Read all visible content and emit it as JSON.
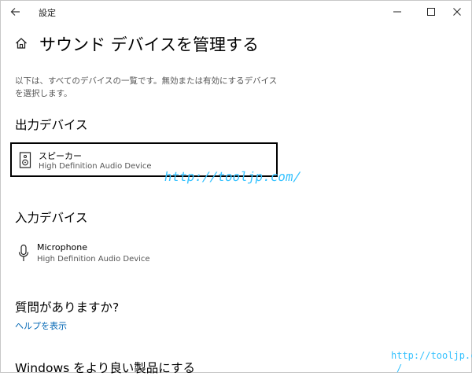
{
  "window": {
    "title": "設定",
    "icons": {
      "back": "back-arrow-icon",
      "minimize": "minimize-icon",
      "maximize": "maximize-icon",
      "close": "close-icon"
    }
  },
  "page": {
    "title": "サウンド デバイスを管理する",
    "description": "以下は、すべてのデバイスの一覧です。無効または有効にするデバイスを選択します。"
  },
  "output_section": {
    "heading": "出力デバイス",
    "devices": [
      {
        "name": "スピーカー",
        "subtitle": "High Definition Audio Device",
        "icon": "speaker-icon"
      }
    ]
  },
  "input_section": {
    "heading": "入力デバイス",
    "devices": [
      {
        "name": "Microphone",
        "subtitle": "High Definition Audio Device",
        "icon": "microphone-icon"
      }
    ]
  },
  "help": {
    "heading": "質問がありますか?",
    "link": "ヘルプを表示"
  },
  "improve": {
    "heading": "Windows をより良い製品にする"
  },
  "watermarks": [
    "http://tooljp.com/",
    "http://tooljp.com",
    "/"
  ],
  "colors": {
    "link": "#0066b4",
    "watermark": "#35c2ff",
    "selection_border": "#000000"
  }
}
